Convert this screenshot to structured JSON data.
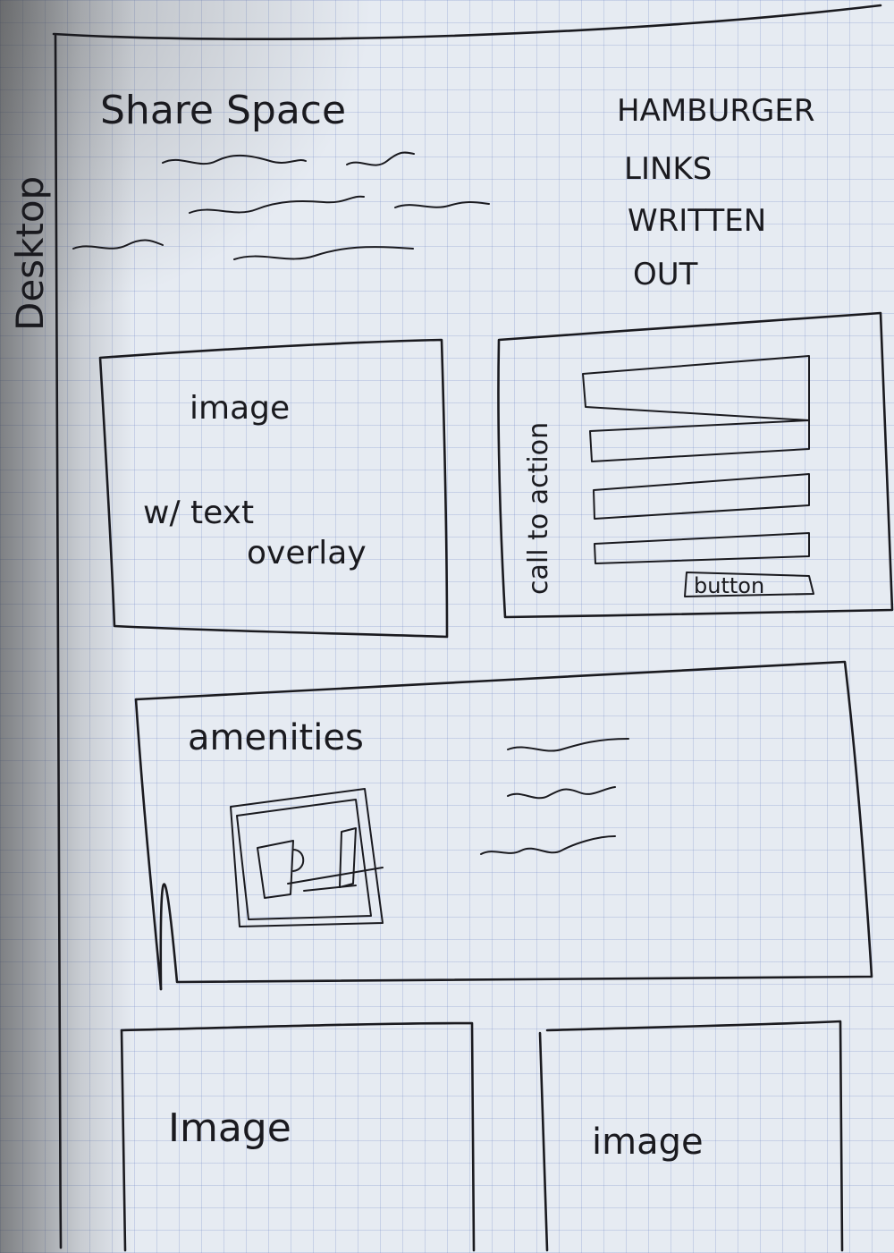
{
  "sketch": {
    "side_label": "Desktop",
    "header": {
      "title": "Share Space",
      "nav_note": [
        "HAMBURGER",
        "LINKS",
        "WRITTEN",
        "OUT"
      ]
    },
    "hero_image": {
      "line1": "image",
      "line2": "w/ text",
      "line3": "overlay"
    },
    "cta_form": {
      "label": "call to action",
      "button": "button",
      "field_count": 4
    },
    "amenities": {
      "title": "amenities",
      "icon": "coffee-laptop-icon"
    },
    "gallery": [
      {
        "label": "Image"
      },
      {
        "label": "image"
      }
    ]
  }
}
